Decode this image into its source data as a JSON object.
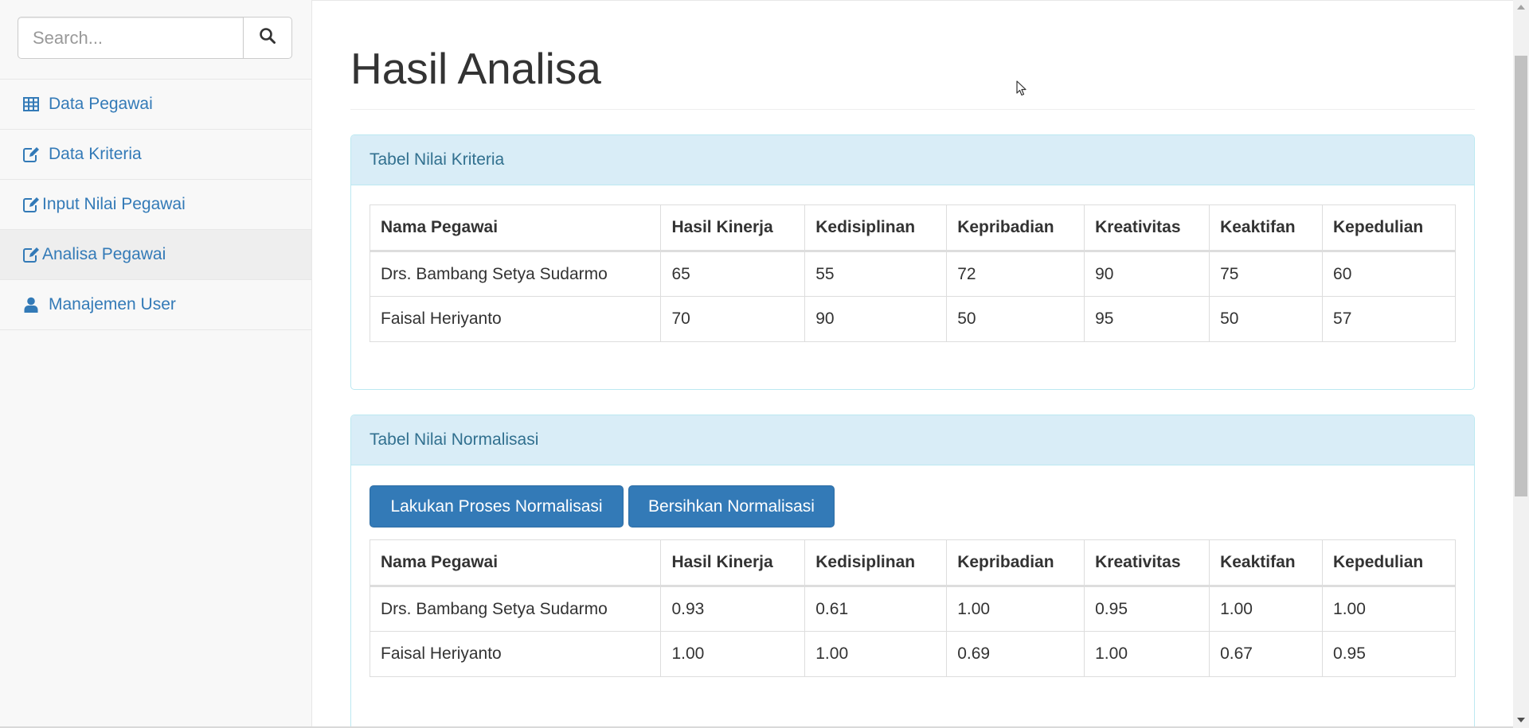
{
  "search": {
    "placeholder": "Search..."
  },
  "sidebar": {
    "items": [
      {
        "label": "Data Pegawai",
        "icon": "table-icon"
      },
      {
        "label": "Data Kriteria",
        "icon": "edit-icon"
      },
      {
        "label": "Input Nilai Pegawai",
        "icon": "edit-icon"
      },
      {
        "label": "Analisa Pegawai",
        "icon": "edit-icon",
        "active": true
      },
      {
        "label": "Manajemen User",
        "icon": "user-icon"
      }
    ]
  },
  "page": {
    "title": "Hasil Analisa"
  },
  "kriteria_panel": {
    "title": "Tabel Nilai Kriteria",
    "columns": [
      "Nama Pegawai",
      "Hasil Kinerja",
      "Kedisiplinan",
      "Kepribadian",
      "Kreativitas",
      "Keaktifan",
      "Kepedulian"
    ],
    "rows": [
      [
        "Drs. Bambang Setya Sudarmo",
        "65",
        "55",
        "72",
        "90",
        "75",
        "60"
      ],
      [
        "Faisal Heriyanto",
        "70",
        "90",
        "50",
        "95",
        "50",
        "57"
      ]
    ]
  },
  "normalisasi_panel": {
    "title": "Tabel Nilai Normalisasi",
    "proses_label": "Lakukan Proses Normalisasi",
    "bersihkan_label": "Bersihkan Normalisasi",
    "columns": [
      "Nama Pegawai",
      "Hasil Kinerja",
      "Kedisiplinan",
      "Kepribadian",
      "Kreativitas",
      "Keaktifan",
      "Kepedulian"
    ],
    "rows": [
      [
        "Drs. Bambang Setya Sudarmo",
        "0.93",
        "0.61",
        "1.00",
        "0.95",
        "1.00",
        "1.00"
      ],
      [
        "Faisal Heriyanto",
        "1.00",
        "1.00",
        "0.69",
        "1.00",
        "0.67",
        "0.95"
      ]
    ]
  },
  "colors": {
    "link": "#337ab7",
    "panel_heading_bg": "#d9edf7",
    "panel_heading_text": "#31708f",
    "button_primary": "#337ab7"
  }
}
